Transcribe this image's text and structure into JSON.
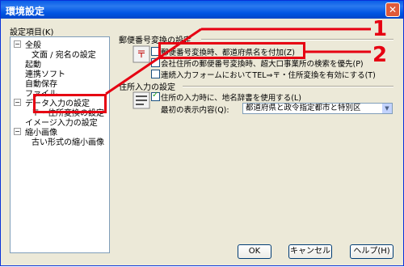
{
  "window": {
    "title": "環境設定",
    "close_glyph": "✕"
  },
  "tree": {
    "label": "設定項目(K)",
    "items": [
      {
        "label": "全般"
      },
      {
        "label": "文面 / 宛名の設定"
      },
      {
        "label": "起動"
      },
      {
        "label": "連携ソフト"
      },
      {
        "label": "自動保存"
      },
      {
        "label": "ファイル"
      },
      {
        "label": "データ入力の設定"
      },
      {
        "label": "〒・住所変換の設定"
      },
      {
        "label": "イメージ入力の設定"
      },
      {
        "label": "縮小画像"
      },
      {
        "label": "古い形式の縮小画像"
      }
    ],
    "twisty_glyph": "−"
  },
  "postal": {
    "group_label": "郵便番号変換の設定",
    "options": [
      {
        "label": "郵便番号変換時、都道府県名を付加(Z)",
        "checked": false
      },
      {
        "label": "会社住所の郵便番号変換時、超大口事業所の検索を優先(P)",
        "checked": true
      },
      {
        "label": "連続入力フォームにおいてTEL⇒〒・住所変換を有効にする(T)",
        "checked": false
      }
    ]
  },
  "address": {
    "group_label": "住所入力の設定",
    "option": {
      "label": "住所の入力時に、地名辞書を使用する(L)",
      "checked": true
    },
    "display_label": "最初の表示内容(Q):",
    "display_value": "都道府県と政令指定都市と特別区"
  },
  "buttons": {
    "ok": "OK",
    "cancel": "キャンセル",
    "help": "ヘルプ(H)"
  },
  "callouts": {
    "one": "1",
    "two": "2"
  },
  "colors": {
    "title_bar": "#0054e3",
    "highlight": "#e60012",
    "dialog_bg": "#ece9d8"
  }
}
